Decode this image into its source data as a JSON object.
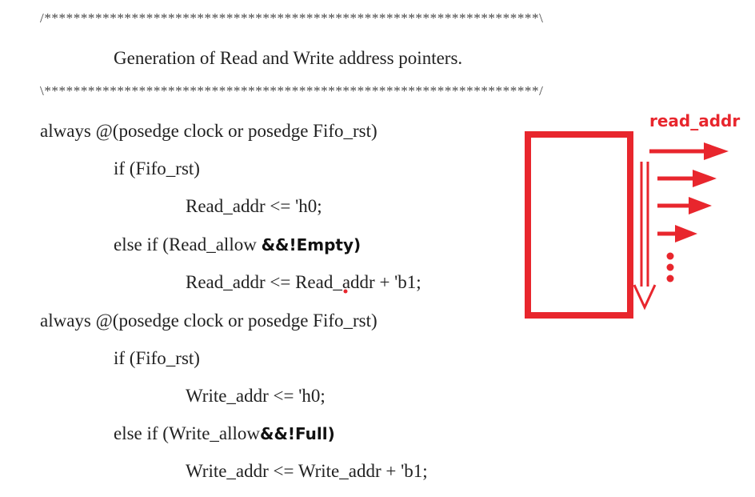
{
  "code": {
    "comment_top": "/********************************************************************\\",
    "heading": "Generation of Read and Write address pointers.",
    "comment_bottom": "\\********************************************************************/",
    "line1": "always @(posedge clock or posedge Fifo_rst)",
    "line2": "if (Fifo_rst)",
    "line3": "Read_addr <= 'h0;",
    "line4_prefix": "else if (Read_allow ",
    "line4_annotation": "&&!Empty)",
    "line5": "Read_addr <= Read_addr + 'b1;",
    "line6": "always @(posedge clock or posedge Fifo_rst)",
    "line7": "if (Fifo_rst)",
    "line8": "Write_addr <= 'h0;",
    "line9_prefix": "else if (Write_allow",
    "line9_annotation": "&&!Full)",
    "line10": "Write_addr <= Write_addr + 'b1;"
  },
  "annotation": {
    "label": "read_addr",
    "color": "#e8262d"
  }
}
